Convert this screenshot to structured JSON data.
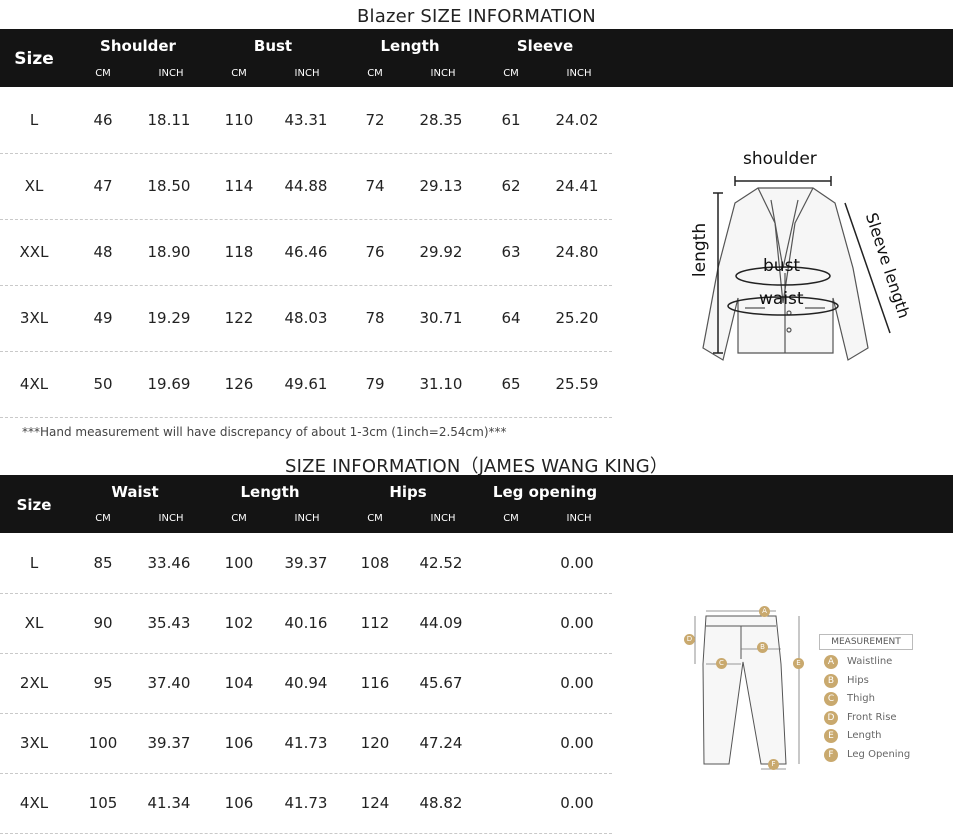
{
  "blazer": {
    "title": "Blazer SIZE INFORMATION",
    "size_label": "Size",
    "groups": [
      "Shoulder",
      "Bust",
      "Length",
      "Sleeve"
    ],
    "units": [
      "CM",
      "INCH",
      "CM",
      "INCH",
      "CM",
      "INCH",
      "CM",
      "INCH"
    ],
    "rows": [
      [
        "L",
        "46",
        "18.11",
        "110",
        "43.31",
        "72",
        "28.35",
        "61",
        "24.02"
      ],
      [
        "XL",
        "47",
        "18.50",
        "114",
        "44.88",
        "74",
        "29.13",
        "62",
        "24.41"
      ],
      [
        "XXL",
        "48",
        "18.90",
        "118",
        "46.46",
        "76",
        "29.92",
        "63",
        "24.80"
      ],
      [
        "3XL",
        "49",
        "19.29",
        "122",
        "48.03",
        "78",
        "30.71",
        "64",
        "25.20"
      ],
      [
        "4XL",
        "50",
        "19.69",
        "126",
        "49.61",
        "79",
        "31.10",
        "65",
        "25.59"
      ]
    ],
    "note": "***Hand measurement will have discrepancy of about 1-3cm (1inch=2.54cm)***",
    "diagram": {
      "shoulder": "shoulder",
      "length": "length",
      "bust": "bust",
      "waist": "waist",
      "sleeve": "Sleeve length"
    }
  },
  "pants": {
    "title": "SIZE INFORMATION（JAMES WANG KING）",
    "size_label": "Size",
    "groups": [
      "Waist",
      "Length",
      "Hips",
      "Leg opening"
    ],
    "units": [
      "CM",
      "INCH",
      "CM",
      "INCH",
      "CM",
      "INCH",
      "CM",
      "INCH"
    ],
    "rows": [
      [
        "L",
        "85",
        "33.46",
        "100",
        "39.37",
        "108",
        "42.52",
        "",
        "0.00"
      ],
      [
        "XL",
        "90",
        "35.43",
        "102",
        "40.16",
        "112",
        "44.09",
        "",
        "0.00"
      ],
      [
        "2XL",
        "95",
        "37.40",
        "104",
        "40.94",
        "116",
        "45.67",
        "",
        "0.00"
      ],
      [
        "3XL",
        "100",
        "39.37",
        "106",
        "41.73",
        "120",
        "47.24",
        "",
        "0.00"
      ],
      [
        "4XL",
        "105",
        "41.34",
        "106",
        "41.73",
        "124",
        "48.82",
        "",
        "0.00"
      ]
    ],
    "diagram": {
      "heading": "MEASUREMENT",
      "legend": [
        {
          "letter": "A",
          "label": "Waistline"
        },
        {
          "letter": "B",
          "label": "Hips"
        },
        {
          "letter": "C",
          "label": "Thigh"
        },
        {
          "letter": "D",
          "label": "Front Rise"
        },
        {
          "letter": "E",
          "label": "Length"
        },
        {
          "letter": "F",
          "label": "Leg Opening"
        }
      ],
      "marker_color": "#c9a96e"
    }
  }
}
